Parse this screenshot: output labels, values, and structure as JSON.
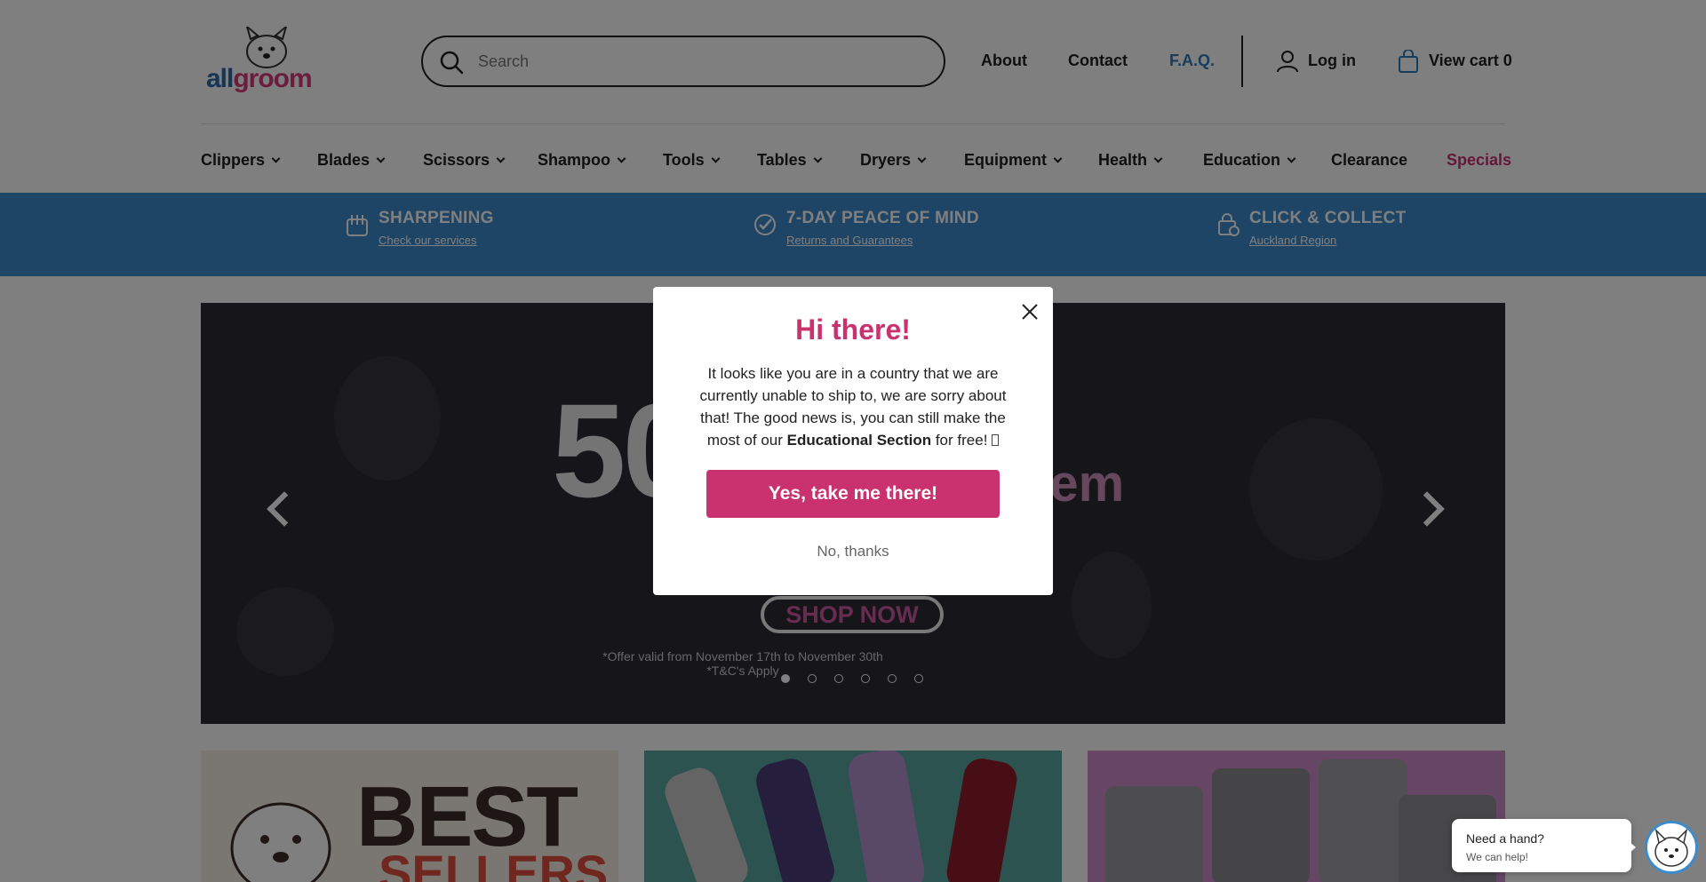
{
  "header": {
    "logo_text_a": "all",
    "logo_text_b": "groom",
    "search_placeholder": "Search",
    "links": {
      "about": "About",
      "contact": "Contact",
      "faq": "F.A.Q.",
      "login": "Log in",
      "cart": "View cart 0"
    }
  },
  "nav": {
    "items": [
      "Clippers",
      "Blades",
      "Scissors",
      "Shampoo",
      "Tools",
      "Tables",
      "Dryers",
      "Equipment",
      "Health",
      "Education",
      "Clearance",
      "Specials"
    ]
  },
  "features": [
    {
      "title": "SHARPENING",
      "sub": "Check our services",
      "icon": "scissors-comb-icon"
    },
    {
      "title": "7-DAY PEACE OF MIND",
      "sub": "Returns and Guarantees",
      "icon": "check-circle-icon"
    },
    {
      "title": "CLICK & COLLECT",
      "sub": "Auckland Region",
      "icon": "shopping-bag-icon"
    }
  ],
  "hero": {
    "big_text": "50",
    "item_text": "Item",
    "shop_now": "SHOP NOW",
    "offer": "*Offer valid from November 17th to November 30th",
    "tcs": "*T&C's Apply",
    "slide_count": 6,
    "active_slide": 1
  },
  "cards": {
    "best": "BEST",
    "sellers": "SELLERS"
  },
  "modal": {
    "title": "Hi there!",
    "body_pre": "It looks like you are in a country that we are currently unable to ship to, we are sorry about that! The good news is, you can still make the most of our ",
    "body_bold": "Educational Section",
    "body_post": " for free! ",
    "cta": "Yes, take me there!",
    "decline": "No, thanks"
  },
  "chat": {
    "line1": "Need a hand?",
    "line2": "We can help!"
  },
  "colors": {
    "brand_pink": "#c9316f",
    "brand_blue": "#3d8bcb",
    "link_blue": "#2f7ab9"
  }
}
